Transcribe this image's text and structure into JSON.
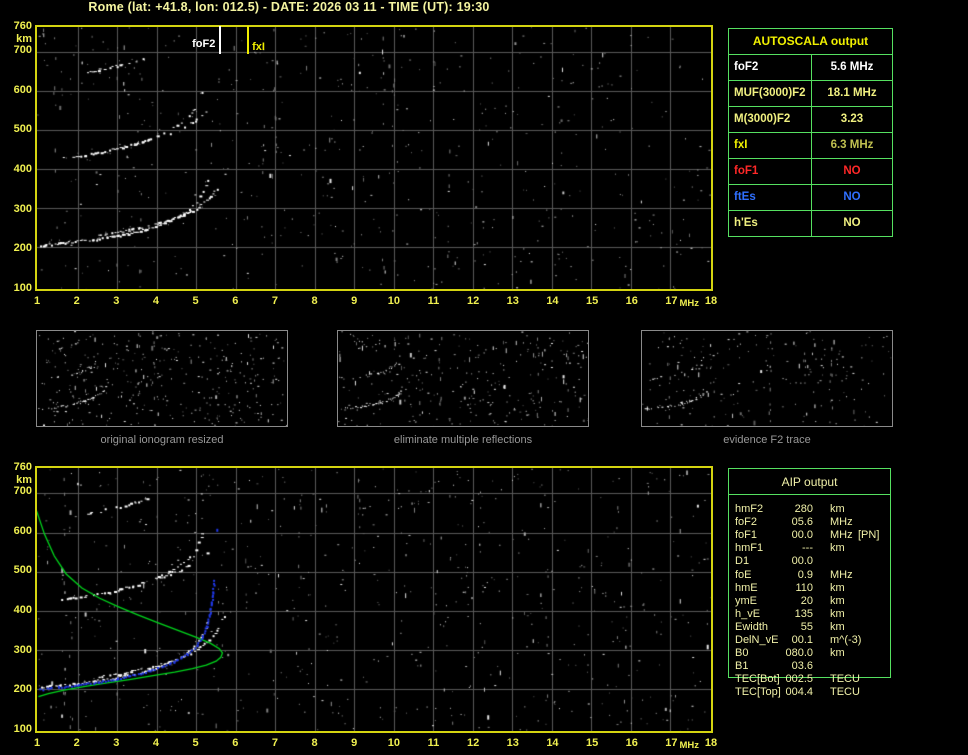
{
  "title": "Rome (lat: +41.8, lon: 012.5) - DATE: 2026 03 11 - TIME (UT): 19:30",
  "colors": {
    "background": "#000000",
    "plot_border": "#d4d410",
    "grid": "#5a5a5a",
    "axis_text": "#f0f050",
    "table_border": "#55e060",
    "noise_grays": [
      "#585858",
      "#6a6a6a",
      "#7e7e7e",
      "#929292",
      "#aaaaaa",
      "#c4c4c4"
    ],
    "trace_white": "#ffffff",
    "profile_green": "#00d81c",
    "restored_blue": "#2038e8"
  },
  "axes": {
    "f_min": 1,
    "f_max": 18,
    "h_min": 100,
    "h_max": 760,
    "x_ticks": [
      1,
      2,
      3,
      4,
      5,
      6,
      7,
      8,
      9,
      10,
      11,
      12,
      13,
      14,
      15,
      16,
      17,
      18
    ],
    "x_unit": "MHz",
    "y_ticks": [
      760,
      700,
      600,
      500,
      400,
      300,
      200,
      100
    ],
    "y_unit": "km"
  },
  "main_plot": {
    "markers": [
      {
        "id": "fof2",
        "label": "foF2",
        "f": 5.6,
        "color": "#ffffff",
        "side": "left",
        "dy": 0
      },
      {
        "id": "fxi",
        "label": "fxI",
        "f": 6.3,
        "color": "#f0ee00",
        "side": "right",
        "dy": 3
      }
    ],
    "noise": {
      "seed": 7,
      "count": 520,
      "white": 0.32,
      "cols": 8
    }
  },
  "restored_plot": {
    "noise": {
      "seed": 23,
      "count": 640,
      "white": 0.26,
      "cols": 9
    },
    "profile": {
      "color": "#00d81c",
      "points": [
        [
          0.95,
          656
        ],
        [
          1.15,
          596
        ],
        [
          1.4,
          540
        ],
        [
          1.7,
          494
        ],
        [
          2.1,
          458
        ],
        [
          2.55,
          432
        ],
        [
          3.0,
          411
        ],
        [
          3.5,
          390
        ],
        [
          4.0,
          370
        ],
        [
          4.5,
          351
        ],
        [
          5.0,
          332
        ],
        [
          5.35,
          317
        ],
        [
          5.58,
          303
        ],
        [
          5.66,
          292
        ],
        [
          5.62,
          281
        ],
        [
          5.5,
          271
        ],
        [
          5.25,
          261
        ],
        [
          4.9,
          252
        ],
        [
          4.45,
          243
        ],
        [
          3.9,
          234
        ],
        [
          3.3,
          224
        ],
        [
          2.7,
          215
        ],
        [
          2.15,
          206
        ],
        [
          1.65,
          197
        ],
        [
          1.25,
          188
        ],
        [
          1.0,
          180
        ]
      ]
    },
    "blue_trace": {
      "color": "#2038e8",
      "points": [
        [
          1.02,
          200
        ],
        [
          1.5,
          206
        ],
        [
          2.0,
          212
        ],
        [
          2.5,
          219
        ],
        [
          3.0,
          228
        ],
        [
          3.5,
          239
        ],
        [
          4.0,
          254
        ],
        [
          4.4,
          270
        ],
        [
          4.75,
          290
        ],
        [
          5.0,
          312
        ],
        [
          5.15,
          336
        ],
        [
          5.25,
          362
        ],
        [
          5.32,
          392
        ],
        [
          5.37,
          420
        ],
        [
          5.4,
          448
        ],
        [
          5.43,
          478
        ]
      ],
      "extra": [
        [
          5.53,
          607
        ]
      ]
    }
  },
  "traces": [
    {
      "name": "F2-hop1-O",
      "density": 0.88,
      "points": [
        [
          1.05,
          206
        ],
        [
          1.5,
          210
        ],
        [
          2.0,
          216
        ],
        [
          2.5,
          222
        ],
        [
          3.0,
          230
        ],
        [
          3.5,
          241
        ],
        [
          4.0,
          256
        ],
        [
          4.4,
          272
        ],
        [
          4.75,
          292
        ],
        [
          5.0,
          315
        ],
        [
          5.15,
          342
        ],
        [
          5.27,
          372
        ],
        [
          5.33,
          398
        ]
      ]
    },
    {
      "name": "F2-hop1-X",
      "density": 0.68,
      "points": [
        [
          2.5,
          230
        ],
        [
          3.2,
          243
        ],
        [
          3.9,
          258
        ],
        [
          4.5,
          277
        ],
        [
          5.0,
          300
        ],
        [
          5.35,
          330
        ],
        [
          5.6,
          365
        ],
        [
          5.75,
          400
        ]
      ]
    },
    {
      "name": "F2-hop2-O",
      "density": 0.5,
      "points": [
        [
          1.6,
          430
        ],
        [
          2.2,
          438
        ],
        [
          2.8,
          450
        ],
        [
          3.4,
          465
        ],
        [
          3.9,
          482
        ],
        [
          4.35,
          503
        ],
        [
          4.7,
          528
        ],
        [
          4.95,
          556
        ],
        [
          5.1,
          588
        ],
        [
          5.18,
          612
        ]
      ]
    },
    {
      "name": "F2-hop2-X",
      "density": 0.35,
      "points": [
        [
          3.3,
          462
        ],
        [
          3.9,
          478
        ],
        [
          4.5,
          500
        ],
        [
          5.0,
          528
        ],
        [
          5.3,
          552
        ]
      ]
    },
    {
      "name": "F2-hop3",
      "density": 0.5,
      "points": [
        [
          2.25,
          650
        ],
        [
          2.7,
          660
        ],
        [
          3.15,
          670
        ],
        [
          3.55,
          682
        ],
        [
          3.85,
          694
        ]
      ]
    }
  ],
  "thumbnails": [
    {
      "caption": "original ionogram resized",
      "seed": 3,
      "noise": 330,
      "white": 0.5,
      "traceMul": 0.85
    },
    {
      "caption": "eliminate multiple reflections",
      "seed": 4,
      "noise": 290,
      "white": 0.45,
      "traceMul": 0.8
    },
    {
      "caption": "evidence F2 trace",
      "seed": 5,
      "noise": 185,
      "white": 0.4,
      "traceMul": 0.7
    }
  ],
  "autoscala_table": {
    "title": "AUTOSCALA output",
    "rows": [
      {
        "label": "foF2",
        "value": "5.6 MHz",
        "color": "#ffffff",
        "value_color": "#ffffff"
      },
      {
        "label": "MUF(3000)F2",
        "value": "18.1 MHz",
        "color": "#f0f080",
        "value_color": "#f0f080"
      },
      {
        "label": "M(3000)F2",
        "value": "3.23",
        "color": "#f0f080",
        "value_color": "#f0f080"
      },
      {
        "label": "fxI",
        "value": "6.3 MHz",
        "color": "#f0f000",
        "value_color": "#c0c050"
      },
      {
        "label": "foF1",
        "value": "NO",
        "color": "#ff2828",
        "value_color": "#ff2828"
      },
      {
        "label": "ftEs",
        "value": "NO",
        "color": "#3070ff",
        "value_color": "#3070ff"
      },
      {
        "label": "h'Es",
        "value": "NO",
        "color": "#f0f080",
        "value_color": "#f0f080"
      }
    ]
  },
  "aip_table": {
    "title": "AIP output",
    "rows": [
      {
        "label": "hmF2",
        "value": "280",
        "unit": "km",
        "extra": ""
      },
      {
        "label": "foF2",
        "value": "05.6",
        "unit": "MHz",
        "extra": ""
      },
      {
        "label": "foF1",
        "value": "00.0",
        "unit": "MHz",
        "extra": "[PN]"
      },
      {
        "label": "hmF1",
        "value": "---",
        "unit": "km",
        "extra": ""
      },
      {
        "label": "D1",
        "value": "00.0",
        "unit": "",
        "extra": ""
      },
      {
        "label": "foE",
        "value": "0.9",
        "unit": "MHz",
        "extra": ""
      },
      {
        "label": "hmE",
        "value": "110",
        "unit": "km",
        "extra": ""
      },
      {
        "label": "ymE",
        "value": "20",
        "unit": "km",
        "extra": ""
      },
      {
        "label": "h_vE",
        "value": "135",
        "unit": "km",
        "extra": ""
      },
      {
        "label": "Ewidth",
        "value": "55",
        "unit": "km",
        "extra": ""
      },
      {
        "label": "DelN_vE",
        "value": "00.1",
        "unit": "m^(-3)",
        "extra": ""
      },
      {
        "label": "B0",
        "value": "080.0",
        "unit": "km",
        "extra": ""
      },
      {
        "label": "B1",
        "value": "03.6",
        "unit": "",
        "extra": ""
      },
      {
        "label": "TEC[Bot]",
        "value": "002.5",
        "unit": "TECU",
        "extra": ""
      },
      {
        "label": "TEC[Top]",
        "value": "004.4",
        "unit": "TECU",
        "extra": ""
      }
    ]
  }
}
